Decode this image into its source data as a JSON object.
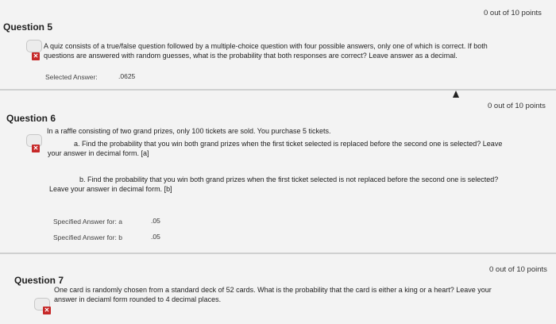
{
  "q5": {
    "title": "Question 5",
    "points": "0 out of 10 points",
    "text_line1": "A quiz consists of a true/false question followed by a multiple-choice question with four possible answers, only one of which is correct.  If both",
    "text_line2": "questions are answered with random guesses, what is the probability that both responses are correct? Leave answer as a decimal.",
    "answer_label": "Selected Answer:",
    "answer_value": ".0625"
  },
  "q6": {
    "title": "Question 6",
    "points": "0 out of 10 points",
    "intro": "In a raffle consisting of two grand prizes, only 100 tickets are sold.  You purchase 5 tickets.",
    "part_a_line1": "a. Find the probability that you win both grand prizes when the first ticket selected is replaced before the second one is selected? Leave",
    "part_a_line2": "your answer in decimal form. [a]",
    "part_b_line1": "b. Find the probability that you win both grand prizes when the first ticket selected is not replaced before the second one is selected?",
    "part_b_line2": "Leave your answer in decimal form. [b]",
    "answers": [
      {
        "label": "Specified Answer for: a",
        "value": ".05"
      },
      {
        "label": "Specified Answer for: b",
        "value": ".05"
      }
    ]
  },
  "q7": {
    "title": "Question 7",
    "points": "0 out of 10 points",
    "text_line1": "One card is randomly chosen from a standard deck of 52 cards. What is the probability that the card is either a king or a heart?  Leave your",
    "text_line2": "answer in deciaml form rounded to 4 decimal places."
  },
  "icons": {
    "incorrect": "x-mark-icon",
    "question_status": "status-icon",
    "cursor": "mouse-cursor-icon"
  },
  "colors": {
    "incorrect": "#c62828",
    "background": "#f3f3f3"
  }
}
